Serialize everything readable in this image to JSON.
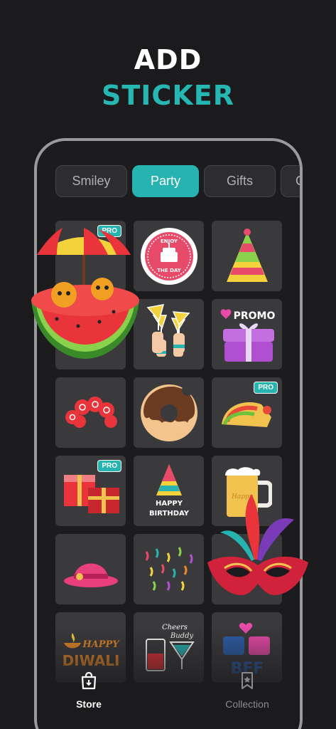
{
  "headline": {
    "line1": "ADD",
    "line2": "STICKER"
  },
  "tabs": [
    {
      "label": "Smiley",
      "active": false
    },
    {
      "label": "Party",
      "active": true
    },
    {
      "label": "Gifts",
      "active": false
    },
    {
      "label": "Cl",
      "active": false
    }
  ],
  "stickers": [
    {
      "name": "watermelon-pool-sticker",
      "badge": "PRO"
    },
    {
      "name": "enjoy-the-day-badge-sticker",
      "text1": "ENJOY",
      "text2": "THE DAY"
    },
    {
      "name": "party-hat-sticker"
    },
    {
      "name": "cocktail-cheers-sticker"
    },
    {
      "name": "champagne-toast-sticker"
    },
    {
      "name": "promo-gift-sticker",
      "text": "PROMO"
    },
    {
      "name": "clown-wig-sticker"
    },
    {
      "name": "donut-sticker"
    },
    {
      "name": "taco-sticker",
      "badge": "PRO"
    },
    {
      "name": "gift-boxes-sticker",
      "badge": "PRO"
    },
    {
      "name": "happy-birthday-sticker",
      "text1": "HAPPY",
      "text2": "BIRTHDAY"
    },
    {
      "name": "beer-mug-sticker",
      "text": "Happy"
    },
    {
      "name": "bowler-hat-sticker"
    },
    {
      "name": "confetti-sticker"
    },
    {
      "name": "carnival-mask-sticker"
    },
    {
      "name": "happy-diwali-sticker",
      "text1": "HAPPY",
      "text2": "DIWALI"
    },
    {
      "name": "cheers-buddy-sticker",
      "text1": "Cheers",
      "text2": "Buddy"
    },
    {
      "name": "bff-sticker",
      "text": "BFF"
    }
  ],
  "nav": {
    "store_label": "Store",
    "collection_label": "Collection",
    "store_icon": "shopping-bag-icon",
    "collection_icon": "bookmark-star-icon"
  },
  "colors": {
    "accent": "#27b3af",
    "background": "#1b1b1d",
    "cell": "#3a3a3d"
  }
}
